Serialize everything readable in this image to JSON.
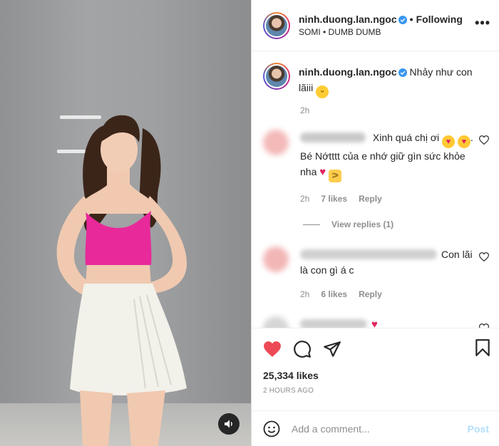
{
  "header": {
    "username": "ninh.duong.lan.ngoc",
    "separator": "•",
    "follow_label": "Following",
    "audio": "SOMI • DUMB DUMB",
    "more": "•••"
  },
  "caption": {
    "username": "ninh.duong.lan.ngoc",
    "text": "Nhảy như con lãiii",
    "time": "2h"
  },
  "comments": [
    {
      "text_a": "Xinh quá chị ơi",
      "text_b": ". Bé Nớtttt của e nhớ giữ gìn sức khỏe nha",
      "time": "2h",
      "likes": "7 likes",
      "reply": "Reply",
      "view_replies": "View replies (1)"
    },
    {
      "text": "Con lãi là con gì á c",
      "time": "2h",
      "likes": "6 likes",
      "reply": "Reply"
    },
    {
      "text": ""
    }
  ],
  "stats": {
    "likes": "25,334 likes",
    "time": "2 HOURS AGO"
  },
  "composer": {
    "placeholder": "Add a comment...",
    "post_label": "Post"
  },
  "colors": {
    "liked_heart": "#ed4956",
    "verified": "#3897f0",
    "post_disabled": "#b2dffc",
    "top_color": "#e8299a"
  }
}
